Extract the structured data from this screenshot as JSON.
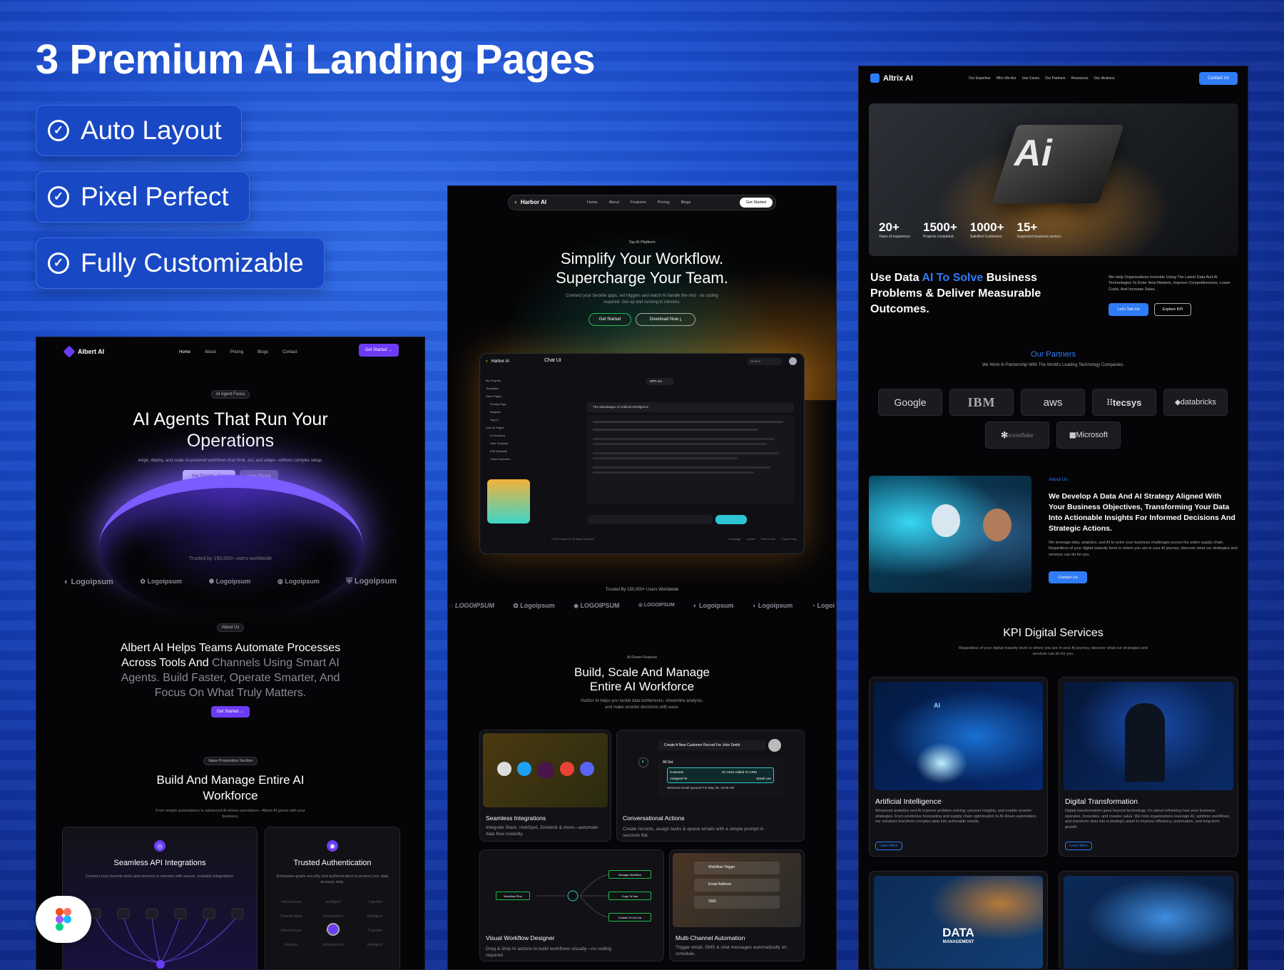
{
  "headline": "3 Premium Ai Landing Pages",
  "features": [
    "Auto Layout",
    "Pixel Perfect",
    "Fully Customizable"
  ],
  "albert": {
    "brand": "Albert AI",
    "nav": [
      "Home",
      "About",
      "Pricing",
      "Blogs",
      "Contact"
    ],
    "cta": "Get Started",
    "badge": "AI Agent Focus",
    "title": "AI Agents That Run Your Operations",
    "sub": "esign, deploy, and scale AI-powered workflows that think, act, and adapt—without complex setup.",
    "btn1": "Get Started - Free",
    "btn2": "View Pricing",
    "trusted": "Trusted by 150,000+ users worldwide",
    "logos": [
      "Logoipsum",
      "Logoipsum",
      "Logoipsum",
      "Logoipsum",
      "Logoipsum"
    ],
    "about_badge": "About Us",
    "about_white": "Albert AI Helps Teams Automate Processes Across Tools And",
    "about_grey": "Channels Using Smart AI Agents. Build Faster, Operate Smarter, And Focus On What Truly Matters.",
    "about_btn": "Get Started",
    "vp_badge": "Value Proposition Section",
    "vp_title": "Build And Manage Entire AI Workforce",
    "vp_sub": "From simple automations to advanced AI-driven operations—Albert AI grows with your business.",
    "card1_title": "Seamless API Integrations",
    "card1_desc": "Connect your favorite tools and services in minutes with secure, scalable integrations.",
    "card2_title": "Trusted Authentication",
    "card2_desc": "Enterprise-grade security and authentication to protect your data at every step.",
    "grid_words": [
      "Infrastructure",
      "Intelligent",
      "Cognitive",
      "Data Analysis",
      "Infrastructure",
      "Intelligent",
      "Infrastructure",
      "Intelligent",
      "Cognitive",
      "Analysis",
      "Infrastructure",
      "Intelligent"
    ]
  },
  "harbor": {
    "brand": "Harbor AI",
    "nav": [
      "Home",
      "About",
      "Features",
      "Pricing",
      "Blogs"
    ],
    "cta": "Get Started",
    "badge": "Top AI Platform",
    "title1": "Simplify Your Workflow.",
    "title2": "Supercharge Your Team.",
    "sub": "Connect your favorite apps, set triggers and watch AI handle the rest - no coding required. Get up and running in minutes.",
    "btn1": "Get Started",
    "btn2": "Download Now",
    "app_brand": "Harbor AI",
    "app_title": "Chat UI",
    "app_search": "Search",
    "sidebar": [
      "My Projects",
      "Templates",
      "Other Pages",
      "Pricing Page",
      "Register",
      "Sign In",
      "Add-on Pages",
      "AI Invoicing",
      "Note Template",
      "Edit Template",
      "Chats Overview"
    ],
    "model": "GPT-4.5",
    "question": "The advantages of Artificial Intelligence",
    "footer_copy": "© 2025 Harbor AI. All Rights Reserved",
    "footer_links": [
      "Homepage",
      "License",
      "Terms of Use",
      "Privacy Policy"
    ],
    "trusted": "Trusted By 150,000+ Users Worldwide",
    "logos": [
      "LOGOIPSUM",
      "Logoipsum",
      "LOGOIPSUM",
      "LOGOIPSUM",
      "Logoipsum",
      "Logoipsum",
      "Logoi"
    ],
    "sec_badge": "AI-Driven Features",
    "sec_title1": "Build, Scale And Manage",
    "sec_title2": "Entire AI Workforce",
    "sec_sub": "Harbor AI helps you tackle data bottlenecks, streamline analysis, and make smarter decisions with ease.",
    "c1_title": "Seamless Integrations",
    "c1_desc": "Integrate Slack, HubSpot, Zendesk & more—automate data flow instantly.",
    "c2_title": "Conversational Actions",
    "c2_desc": "Create records, assign tasks & queue emails with a simple prompt in seconds flat.",
    "c2_prompt": "Create A New Customer Record For John Smith",
    "c2_allset": "All Set",
    "c2_row1a": "Customer",
    "c2_row1b": "#C-1024 Added To CRM",
    "c2_row2a": "Assigned To",
    "c2_row2b": "Sarah Lee",
    "c2_email": "Welcome Email Queued For May 28, 10:00 AM",
    "c3_title": "Visual Workflow Designer",
    "c3_desc": "Drag & drop AI actions to build workflows visually—no coding required",
    "c3_nodes": [
      "Workflow Plus",
      "Manage Workflow",
      "Copy To Use",
      "Custom To-Do List"
    ],
    "c4_title": "Multi-Channel Automation",
    "c4_desc": "Trigger email, SMS & chat messages automatically on schedule.",
    "c4_rows": [
      "Workflow Trigger",
      "Email Address",
      "SMS"
    ]
  },
  "altrix": {
    "brand": "Altrix AI",
    "nav": [
      "Our Expertise",
      "Who We Are",
      "Use Cases",
      "Our Partners",
      "Resources",
      "Our divisions"
    ],
    "cta": "Contact Us",
    "stats": [
      {
        "n": "20+",
        "l": "Years of experience"
      },
      {
        "n": "1500+",
        "l": "Projects completed"
      },
      {
        "n": "1000+",
        "l": "Satisfied Customers"
      },
      {
        "n": "15+",
        "l": "Supported business sectors"
      }
    ],
    "hero_a": "Use Data",
    "hero_b": "AI To Solve",
    "hero_c": "Business Problems & Deliver Measurable Outcomes.",
    "hero_side": "We Help Organizations Innovate Using The Latest Data And AI Technologies To Enter New Markets, Improve Competitiveness, Lower Costs, And Increase Sales.",
    "btn1": "Let's Talk Us",
    "btn2": "Explore KPI",
    "partners_title": "Our Partners",
    "partners_sub": "We Work In Partnership With The World's Leading Technology Companies.",
    "partners": [
      "Google",
      "IBM",
      "aws",
      "tecsys",
      "databricks",
      "snowflake",
      "Microsoft"
    ],
    "about_badge": "About Us",
    "about_title": "We Develop A Data And AI Strategy Aligned With Your Business Objectives, Transforming Your Data Into Actionable Insights For Informed Decisions And Strategic Actions.",
    "about_desc": "We leverage data, analytics, and AI to solve your business challenges across the entire supply chain. Regardless of your digital maturity level or where you are in your AI journey, discover what our strategies and services can do for you.",
    "about_btn": "Contact Us",
    "kpi_title": "KPI Digital Services",
    "kpi_sub": "Regardless of your digital maturity level or where you are in your AI journey, discover what our strategies and services can do for you.",
    "s1_title": "Artificial Intelligence",
    "s1_desc": "Advanced analytics and AI improve problem-solving, uncover insights, and enable smarter strategies. From predictive forecasting and supply chain optimization to AI-driven automation, our solutions transform complex data into actionable results.",
    "s2_title": "Digital Transformation",
    "s2_desc": "Digital transformation goes beyond technology: it's about rethinking how your business operates, innovates, and creates value. We help organizations leverage AI, optimize workflows, and transform data into a strategic asset to improve efficiency, automation, and long-term growth.",
    "learn": "Learn More",
    "data_mgmt": "DATA",
    "data_mgmt2": "MANAGEMENT",
    "ai_chip": "Ai"
  },
  "colors": {
    "purple": "#6b3cf5",
    "altrix_blue": "#2f7cf6",
    "harbor_cyan": "#2ec6d4"
  }
}
